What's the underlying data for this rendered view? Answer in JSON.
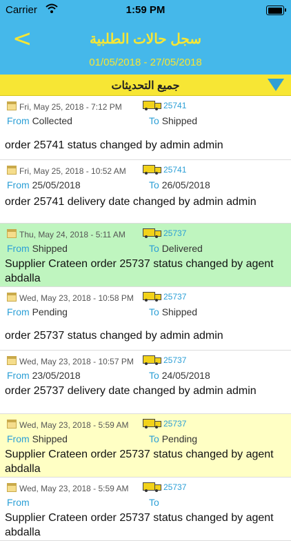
{
  "status_bar": {
    "carrier": "Carrier",
    "time": "1:59 PM"
  },
  "nav": {
    "back_glyph": "<",
    "title": "سجل حالات الطلبية",
    "date_range": "01/05/2018 - 27/05/2018"
  },
  "filter": {
    "label": "جميع التحديثات"
  },
  "labels": {
    "from": "From",
    "to": "To"
  },
  "colors": {
    "header_blue": "#45b8ea",
    "accent_yellow": "#f7e634",
    "link_blue": "#2b9fd6",
    "green_row": "#bff5bf",
    "yellow_row": "#ffffc4"
  },
  "items": [
    {
      "date": "Fri, May 25, 2018 - 7:12 PM",
      "order": "25741",
      "from": "Collected",
      "to": "Shipped",
      "message": "order 25741 status changed by admin admin"
    },
    {
      "date": "Fri, May 25, 2018 - 10:52 AM",
      "order": "25741",
      "from": "25/05/2018",
      "to": "26/05/2018",
      "message": "order 25741 delivery date changed by admin admin"
    },
    {
      "date": "Thu, May 24, 2018 - 5:11 AM",
      "order": "25737",
      "from": "Shipped",
      "to": "Delivered",
      "message": "Supplier Crateen order 25737 status changed by agent abdalla"
    },
    {
      "date": "Wed, May 23, 2018 - 10:58 PM",
      "order": "25737",
      "from": "Pending",
      "to": "Shipped",
      "message": "order 25737 status changed by admin admin"
    },
    {
      "date": "Wed, May 23, 2018 - 10:57 PM",
      "order": "25737",
      "from": "23/05/2018",
      "to": "24/05/2018",
      "message": "order 25737 delivery date changed by admin admin"
    },
    {
      "date": "Wed, May 23, 2018 - 5:59 AM",
      "order": "25737",
      "from": "Shipped",
      "to": "Pending",
      "message": "Supplier Crateen order 25737 status changed by agent abdalla"
    },
    {
      "date": "Wed, May 23, 2018 - 5:59 AM",
      "order": "25737",
      "from": "",
      "to": "",
      "message": "Supplier Crateen order 25737 status changed by agent abdalla"
    }
  ]
}
